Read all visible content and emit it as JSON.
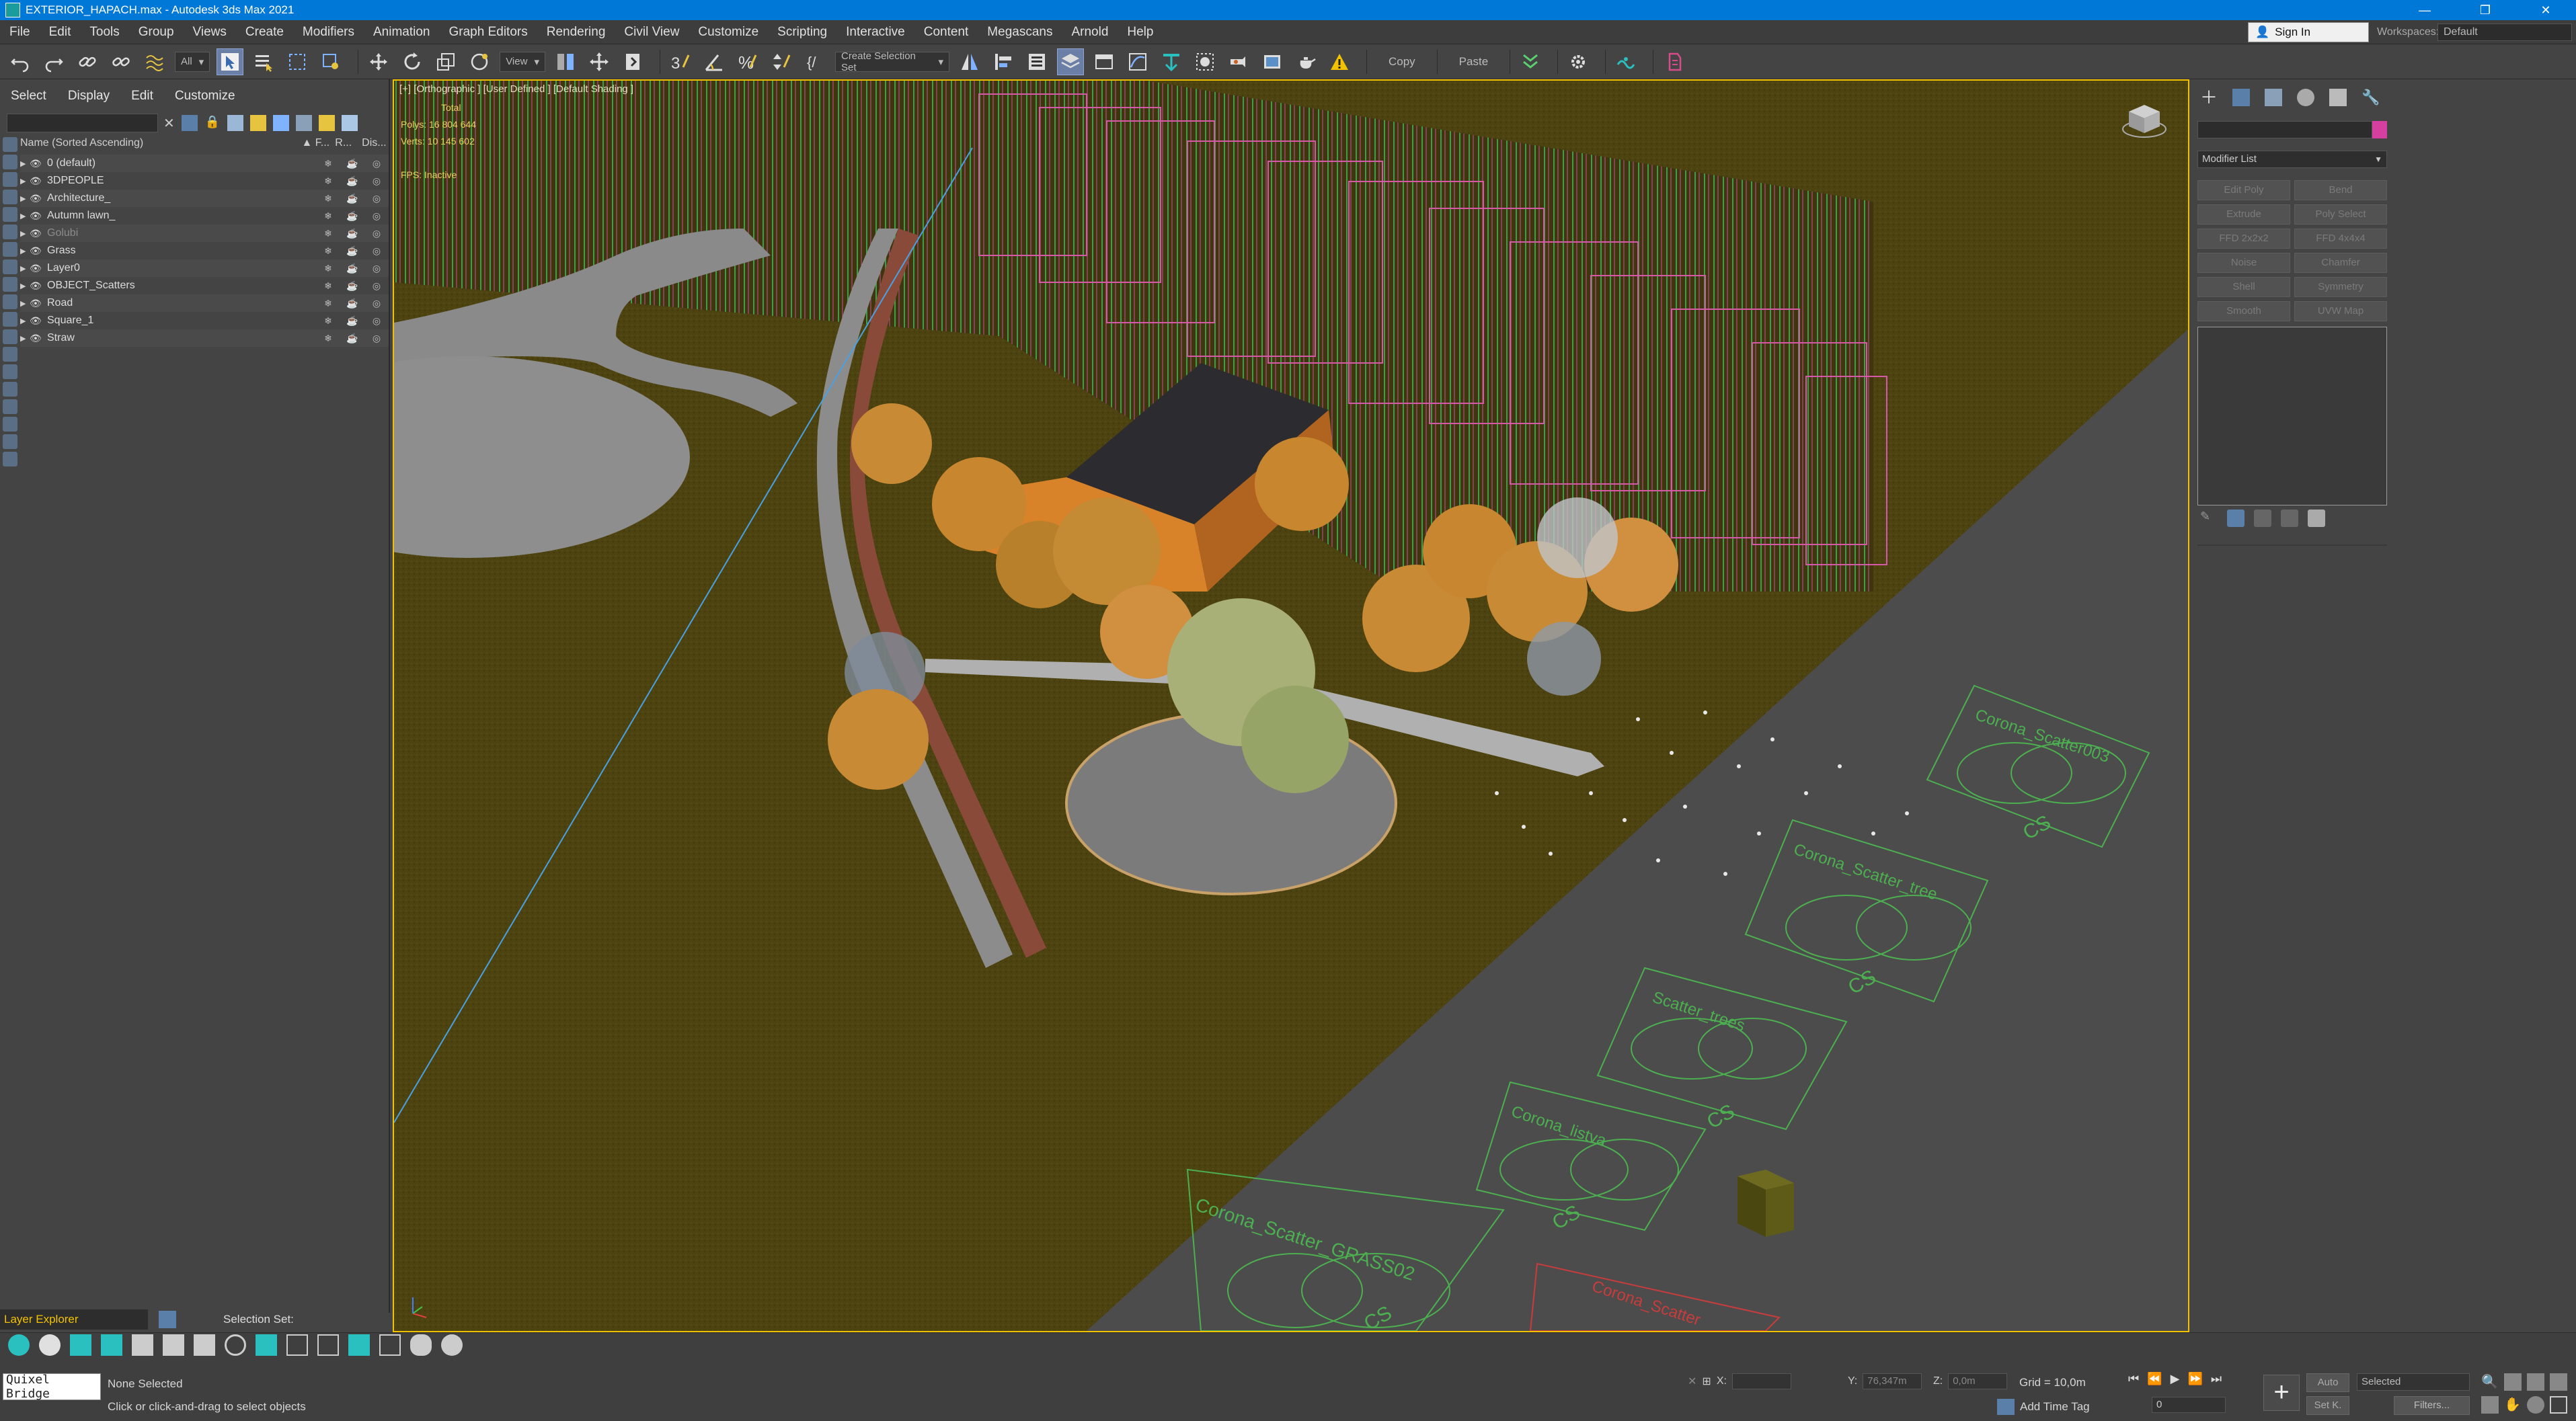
{
  "window": {
    "title": "EXTERIOR_HAPACH.max - Autodesk 3ds Max 2021",
    "controls": [
      "—",
      "❐",
      "✕"
    ]
  },
  "menu": {
    "items": [
      "File",
      "Edit",
      "Tools",
      "Group",
      "Views",
      "Create",
      "Modifiers",
      "Animation",
      "Graph Editors",
      "Rendering",
      "Civil View",
      "Customize",
      "Scripting",
      "Interactive",
      "Content",
      "Megascans",
      "Arnold",
      "Help"
    ],
    "sign_in": "Sign In",
    "workspaces_label": "Workspaces:",
    "workspaces_value": "Default"
  },
  "toolbar": {
    "filter_value": "All",
    "ref_coord_value": "View",
    "selection_set_placeholder": "Create Selection Set",
    "copy_label": "Copy",
    "paste_label": "Paste"
  },
  "explorer": {
    "tabs": [
      "Select",
      "Display",
      "Edit",
      "Customize"
    ],
    "columns": {
      "name": "Name (Sorted Ascending)",
      "frozen": "▲ F...",
      "render": "R...",
      "display": "Dis..."
    },
    "layers": [
      {
        "name": "0 (default)",
        "dim": false
      },
      {
        "name": "3DPEOPLE",
        "dim": false
      },
      {
        "name": "Architecture_",
        "dim": false
      },
      {
        "name": "Autumn lawn_",
        "dim": false
      },
      {
        "name": "Golubi",
        "dim": true
      },
      {
        "name": "Grass",
        "dim": false
      },
      {
        "name": "Layer0",
        "dim": false
      },
      {
        "name": "OBJECT_Scatters",
        "dim": false
      },
      {
        "name": "Road",
        "dim": false
      },
      {
        "name": "Square_1",
        "dim": false
      },
      {
        "name": "Straw",
        "dim": false
      }
    ],
    "footer_label": "Layer Explorer",
    "selection_set_label": "Selection Set:"
  },
  "viewport": {
    "label": "[+] [Orthographic ] [User Defined ] [Default Shading ]",
    "stats_total": "Total",
    "stats_polys": "Polys:   16 804 644",
    "stats_verts": "Verts:   10 145 602",
    "stats_fps": "FPS:     Inactive",
    "scatter_labels": [
      "Corona_Scatter_GRASS02",
      "Corona_listva",
      "Scatter_trees",
      "Corona_Scatter_tree",
      "Corona_Scatter003",
      "Corona_Scatter"
    ],
    "scatter_tags": [
      "CS",
      "CS",
      "CS",
      "CS",
      "CS"
    ]
  },
  "command_panel": {
    "modifier_list": "Modifier List",
    "modifier_buttons": [
      "Edit Poly",
      "Bend",
      "Extrude",
      "Poly Select",
      "FFD 2x2x2",
      "FFD 4x4x4",
      "Noise",
      "Chamfer",
      "Shell",
      "Symmetry",
      "Smooth",
      "UVW Map"
    ],
    "color_swatch": "#d53fa0"
  },
  "status": {
    "quixel_label": "Quixel Bridge",
    "selection_text": "None Selected",
    "hint_text": "Click or click-and-drag to select objects",
    "x_label": "X:",
    "x_value": "",
    "y_label": "Y:",
    "y_value": "76,347m",
    "z_label": "Z:",
    "z_value": "0,0m",
    "grid_text": "Grid = 10,0m",
    "add_time_tag": "Add Time Tag",
    "auto_label": "Auto",
    "setk_label": "Set K.",
    "selected_value": "Selected",
    "filters_label": "Filters...",
    "frame_value": "0"
  }
}
